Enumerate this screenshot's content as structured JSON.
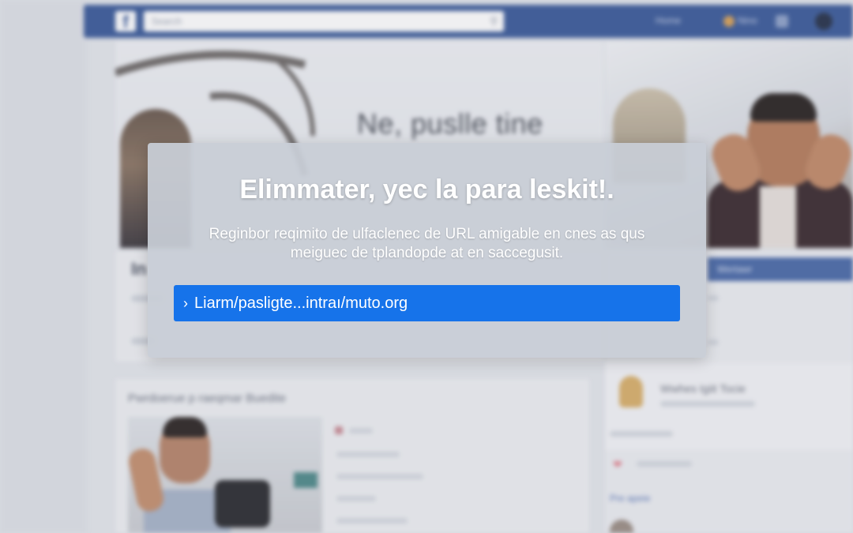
{
  "background": {
    "topbar": {
      "logo": "f",
      "search_placeholder": "Search",
      "nav_home": "Home",
      "nav_user": "Nino"
    },
    "cover_text": "Ne, puslle tine",
    "profile_name_fragment": "In",
    "right_panel_tab": "Wertawr",
    "right_panel_card_text": "Wwhes Igiit Tocie",
    "right_panel_link": "Pre apeie",
    "feed_title": "Pwrdoerue p raeqmar Buedite"
  },
  "modal": {
    "title": "Elimmater, yec la para leskit!.",
    "description_line1": "Reginbor reqimito de ulfaclenec de URL amigable en cnes as qus",
    "description_line2": "meiguec de tplandopde at en saccegusit.",
    "url_chevron": "›",
    "url": "Liarm/pasligte...intraı/muto.org"
  },
  "colors": {
    "accent_blue": "#1673ea",
    "topbar_blue": "#3b5b9a"
  },
  "icons": [
    "facebook-logo-icon",
    "search-icon",
    "chevron-right-icon"
  ]
}
